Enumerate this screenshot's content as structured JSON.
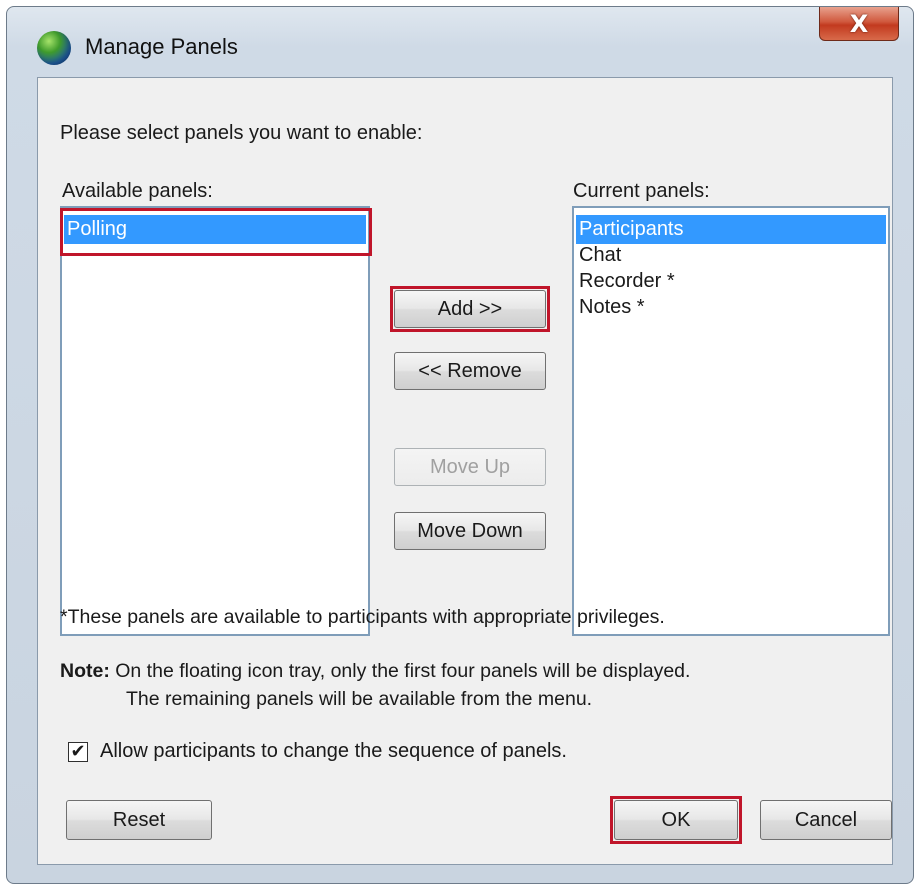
{
  "window": {
    "title": "Manage Panels",
    "close_glyph": "X"
  },
  "dialog": {
    "instruction": "Please select panels you want to enable:",
    "available_label": "Available panels:",
    "current_label": "Current panels:",
    "available_items": [
      "Polling"
    ],
    "current_items": [
      "Participants",
      "Chat",
      "Recorder *",
      "Notes *"
    ],
    "buttons": {
      "add": "Add >>",
      "remove": "<< Remove",
      "move_up": "Move Up",
      "move_down": "Move Down",
      "reset": "Reset",
      "ok": "OK",
      "cancel": "Cancel"
    },
    "footnote": "*These panels are available to participants with appropriate privileges.",
    "note_label": "Note:",
    "note_line1": "On the floating icon tray, only the first four panels will be displayed.",
    "note_line2": "The remaining panels will be available from the menu.",
    "checkbox_label": "Allow participants to change the sequence of panels.",
    "checkbox_checked": true,
    "checkbox_glyph": "✔"
  },
  "colors": {
    "selection": "#3399ff",
    "highlight": "#c0152a",
    "close": "#c23a1f"
  }
}
